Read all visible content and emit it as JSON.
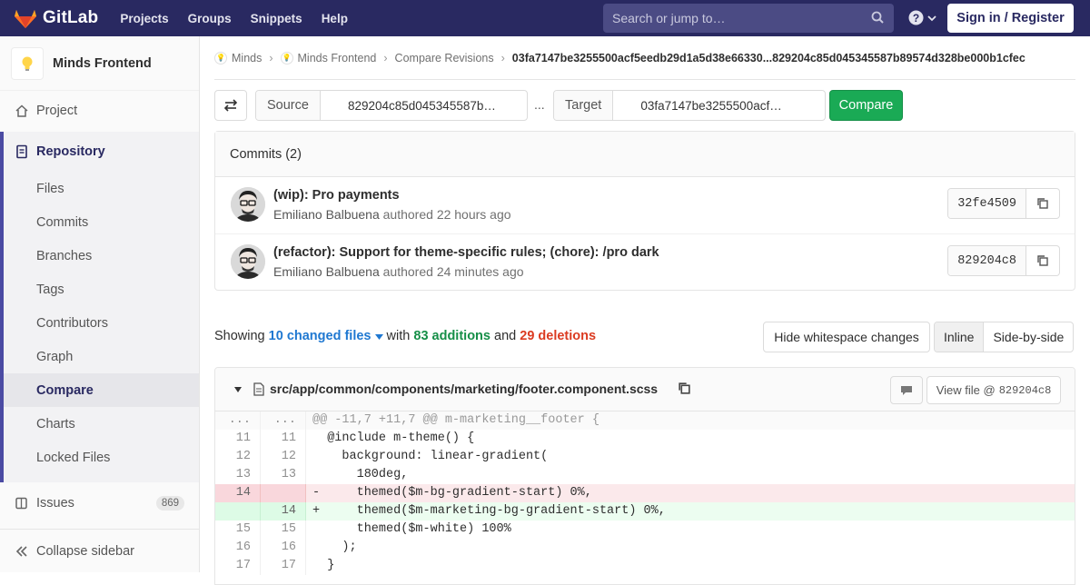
{
  "nav": {
    "brand": "GitLab",
    "links": [
      "Projects",
      "Groups",
      "Snippets",
      "Help"
    ],
    "search_placeholder": "Search or jump to…",
    "signin_label": "Sign in / Register"
  },
  "sidebar": {
    "project_name": "Minds Frontend",
    "project_label": "Project",
    "repository_label": "Repository",
    "repo_items": [
      "Files",
      "Commits",
      "Branches",
      "Tags",
      "Contributors",
      "Graph",
      "Compare",
      "Charts",
      "Locked Files"
    ],
    "active_item": "Compare",
    "issues_label": "Issues",
    "issues_count": "869",
    "collapse_label": "Collapse sidebar"
  },
  "breadcrumb": {
    "items": [
      "Minds",
      "Minds Frontend",
      "Compare Revisions"
    ],
    "current": "03fa7147be3255500acf5eedb29d1a5d38e66330...829204c85d045345587b89574d328be000b1cfec"
  },
  "compare": {
    "source_label": "Source",
    "source_value": "829204c85d045345587b…",
    "separator": "...",
    "target_label": "Target",
    "target_value": "03fa7147be3255500acf…",
    "button_label": "Compare"
  },
  "commits": {
    "header": "Commits (2)",
    "items": [
      {
        "title": "(wip): Pro payments",
        "author": "Emiliano Balbuena",
        "verb": "authored",
        "time": "22 hours ago",
        "sha": "32fe4509"
      },
      {
        "title": "(refactor): Support for theme-specific rules; (chore): /pro dark",
        "author": "Emiliano Balbuena",
        "verb": "authored",
        "time": "24 minutes ago",
        "sha": "829204c8"
      }
    ]
  },
  "stats": {
    "showing": "Showing",
    "files": "10 changed files",
    "with": "with",
    "additions": "83 additions",
    "and": "and",
    "deletions": "29 deletions"
  },
  "diff_options": {
    "whitespace_label": "Hide whitespace changes",
    "inline_label": "Inline",
    "side_by_side_label": "Side-by-side"
  },
  "file": {
    "path": "src/app/common/components/marketing/footer.component.scss",
    "view_file_label": "View file @",
    "view_file_sha": "829204c8",
    "lines": [
      {
        "type": "match",
        "old": "...",
        "new": "...",
        "code": "@@ -11,7 +11,7 @@ m-marketing__footer {"
      },
      {
        "type": "ctx",
        "old": "11",
        "new": "11",
        "code": "  @include m-theme() {"
      },
      {
        "type": "ctx",
        "old": "12",
        "new": "12",
        "code": "    background: linear-gradient("
      },
      {
        "type": "ctx",
        "old": "13",
        "new": "13",
        "code": "      180deg,"
      },
      {
        "type": "old",
        "old": "14",
        "new": "",
        "code": "-     themed($m-bg-gradient-start) 0%,"
      },
      {
        "type": "new",
        "old": "",
        "new": "14",
        "code": "+     themed($m-marketing-bg-gradient-start) 0%,"
      },
      {
        "type": "ctx",
        "old": "15",
        "new": "15",
        "code": "      themed($m-white) 100%"
      },
      {
        "type": "ctx",
        "old": "16",
        "new": "16",
        "code": "    );"
      },
      {
        "type": "ctx",
        "old": "17",
        "new": "17",
        "code": "  }"
      }
    ]
  },
  "colors": {
    "nav_bg": "#292961",
    "accent": "#4b4ba3",
    "compare_green": "#1aaa55",
    "additions": "#168f48",
    "deletions": "#db3b21",
    "link": "#1f78d1"
  }
}
